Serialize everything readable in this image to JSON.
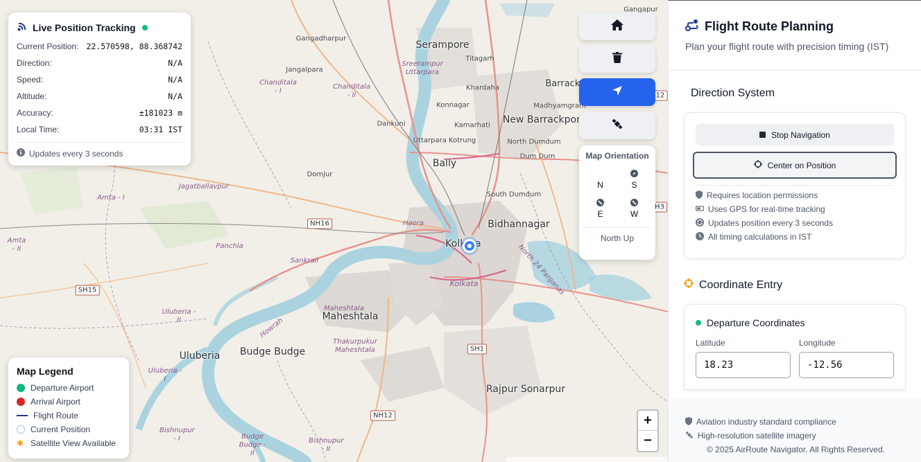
{
  "map": {
    "places_big": [
      {
        "name": "Serampore"
      },
      {
        "name": "New Barrackpore"
      },
      {
        "name": "Bally"
      },
      {
        "name": "Bidhannagar"
      },
      {
        "name": "Kolkata"
      },
      {
        "name": "Maheshtala"
      },
      {
        "name": "Uluberia"
      },
      {
        "name": "Budge Budge"
      },
      {
        "name": "Rajpur Sonarpur"
      }
    ],
    "places_small": [
      "Gangadharpur",
      "Jangalpara",
      "Titagarh",
      "Khardaha",
      "Konnagar",
      "Kamarhati",
      "Dankuni",
      "Uttarpara Kotrung",
      "North Dumdum",
      "Dum Dum",
      "Madhyamgram",
      "Domjur",
      "South Dumdum",
      "Barrackpore",
      "Panchla",
      "Sankrail",
      "Haora",
      "Kolkata",
      "Thakurpukur Maheshtala",
      "Bishnupur - II",
      "Budge Budge - II",
      "Amta - I",
      "Amta - II",
      "Uluberia - II",
      "Uluberia - I",
      "Chanditala - I",
      "Chanditala - II",
      "Jagatballavpur",
      "Sreerampur Uttarpara",
      "North 24 Parganas",
      "Howrah",
      "Maheshtala",
      "Bishnupur - I",
      "Gangapur"
    ],
    "shields": [
      "NH16",
      "SH15",
      "SH1",
      "NH12",
      "H3"
    ],
    "marker_label": "Kolkata"
  },
  "tracking": {
    "title": "Live Position Tracking",
    "rows": [
      {
        "label": "Current Position:",
        "value": "22.570598, 88.368742"
      },
      {
        "label": "Direction:",
        "value": "N/A"
      },
      {
        "label": "Speed:",
        "value": "N/A"
      },
      {
        "label": "Altitude:",
        "value": "N/A"
      },
      {
        "label": "Accuracy:",
        "value": "±181023 m"
      },
      {
        "label": "Local Time:",
        "value": "03:31 IST"
      }
    ],
    "footer": "Updates every 3 seconds",
    "status_color": "#10b981"
  },
  "legend": {
    "title": "Map Legend",
    "items": [
      {
        "label": "Departure Airport",
        "color": "#10b981"
      },
      {
        "label": "Arrival Airport",
        "color": "#dc2626"
      },
      {
        "label": "Flight Route",
        "color": "#1e3a8a"
      },
      {
        "label": "Current Position",
        "color": "#3b82f6"
      },
      {
        "label": "Satellite View Available",
        "color": "#f59e0b"
      }
    ]
  },
  "tools": [
    {
      "icon": "home-icon"
    },
    {
      "icon": "trash-icon"
    },
    {
      "icon": "navigate-arrow-icon"
    },
    {
      "icon": "satellite-icon"
    }
  ],
  "orientation": {
    "title": "Map Orientation",
    "dirs": [
      "N",
      "S",
      "E",
      "W"
    ],
    "footer": "North Up"
  },
  "zoom": {
    "in": "+",
    "out": "−"
  },
  "panel": {
    "title": "Flight Route Planning",
    "subtitle": "Plan your flight route with precision timing (IST)",
    "direction": {
      "title": "Direction System",
      "stop_label": "Stop Navigation",
      "center_label": "Center on Position",
      "notes": [
        "Requires location permissions",
        "Uses GPS for real-time tracking",
        "Updates position every 3 seconds",
        "All timing calculations in IST"
      ]
    },
    "coordinates": {
      "title": "Coordinate Entry",
      "departure_title": "Departure Coordinates",
      "lat_label": "Latitude",
      "lon_label": "Longitude",
      "lat_value": "18.23",
      "lon_value": "-12.56"
    },
    "footer": {
      "line1": "Aviation industry standard compliance",
      "line2": "High-resolution satellite imagery",
      "copyright": "© 2025 AirRoute Navigator. All Rights Reserved."
    },
    "accent": "#2563eb"
  }
}
